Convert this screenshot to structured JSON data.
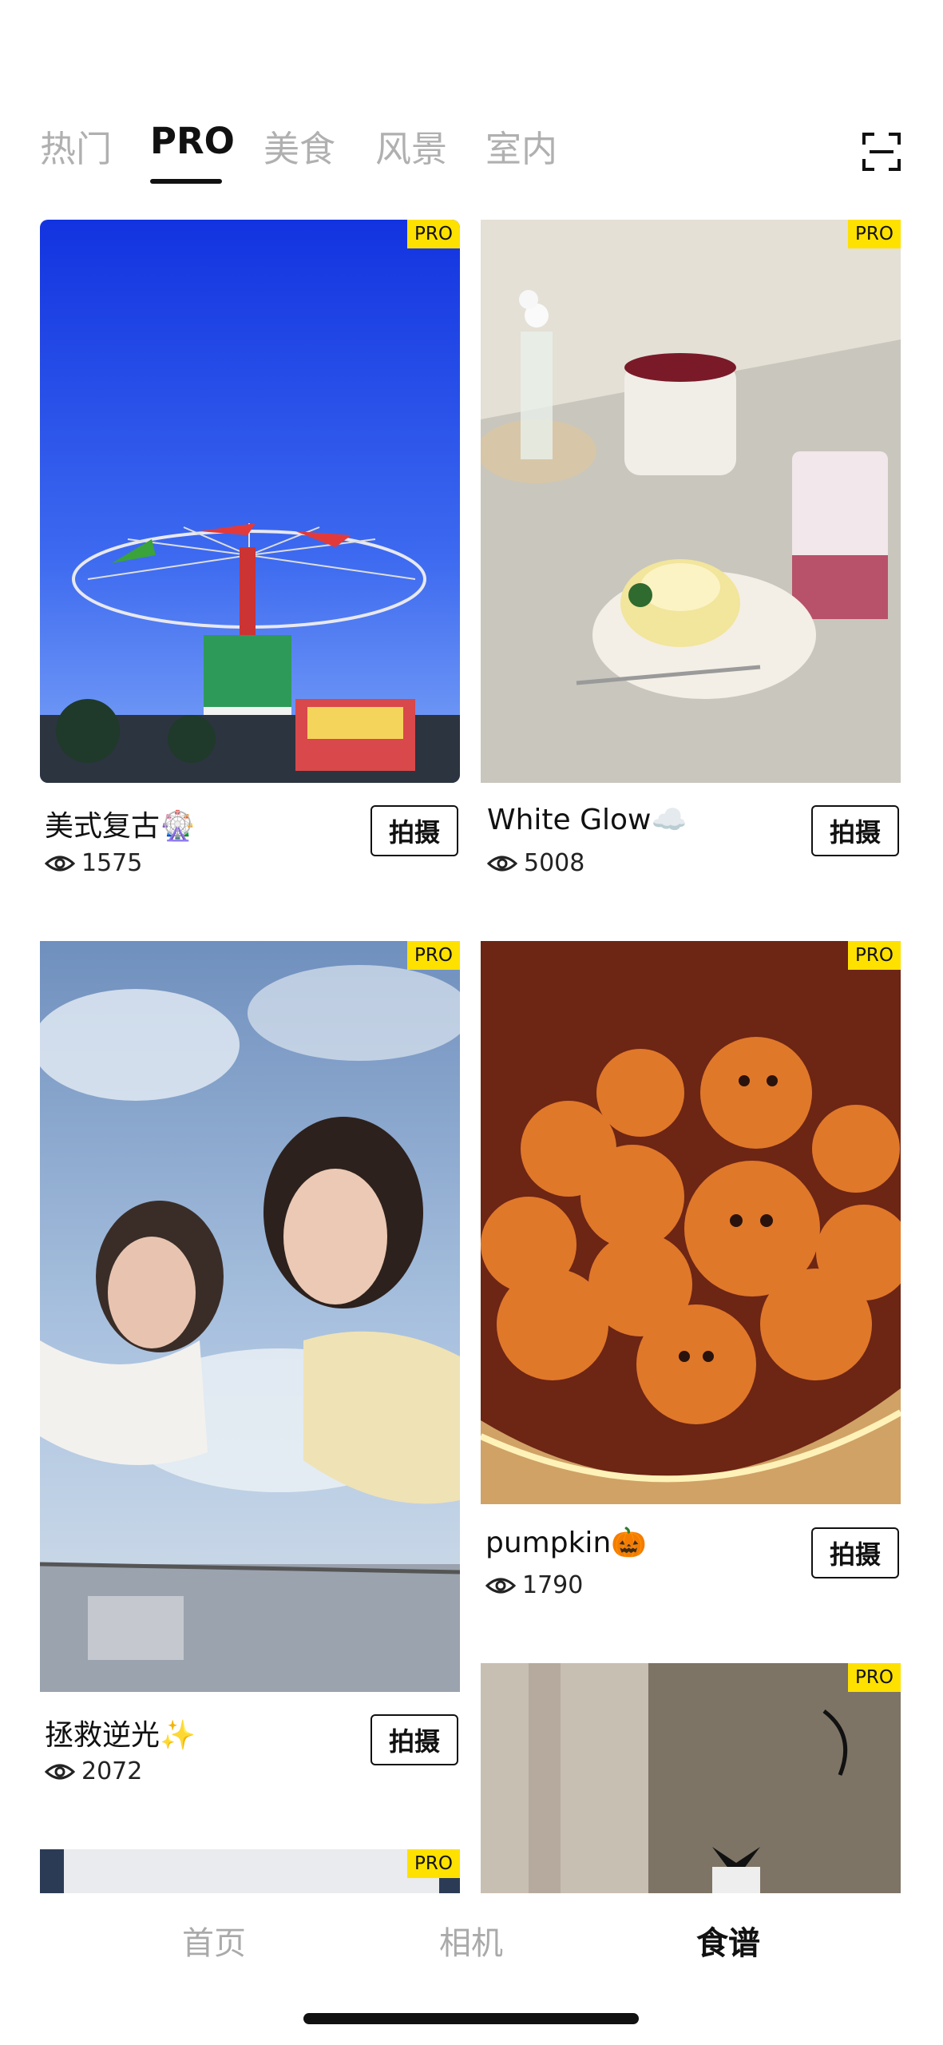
{
  "tabs": [
    {
      "label": "热门",
      "active": false
    },
    {
      "label": "PRO",
      "active": true
    },
    {
      "label": "美食",
      "active": false
    },
    {
      "label": "风景",
      "active": false
    },
    {
      "label": "室内",
      "active": false
    }
  ],
  "badge_label": "PRO",
  "shoot_label": "拍摄",
  "cards": [
    {
      "title": "美式复古🎡",
      "views": "1575"
    },
    {
      "title": "White Glow☁️",
      "views": "5008"
    },
    {
      "title": "拯救逆光✨",
      "views": "2072"
    },
    {
      "title": "pumpkin🎃",
      "views": "1790"
    }
  ],
  "nav": [
    {
      "label": "首页",
      "active": false
    },
    {
      "label": "相机",
      "active": false
    },
    {
      "label": "食谱",
      "active": true
    }
  ],
  "colors": {
    "badge": "#ffe100",
    "active_text": "#111111",
    "inactive_text": "#b0b0b0"
  }
}
